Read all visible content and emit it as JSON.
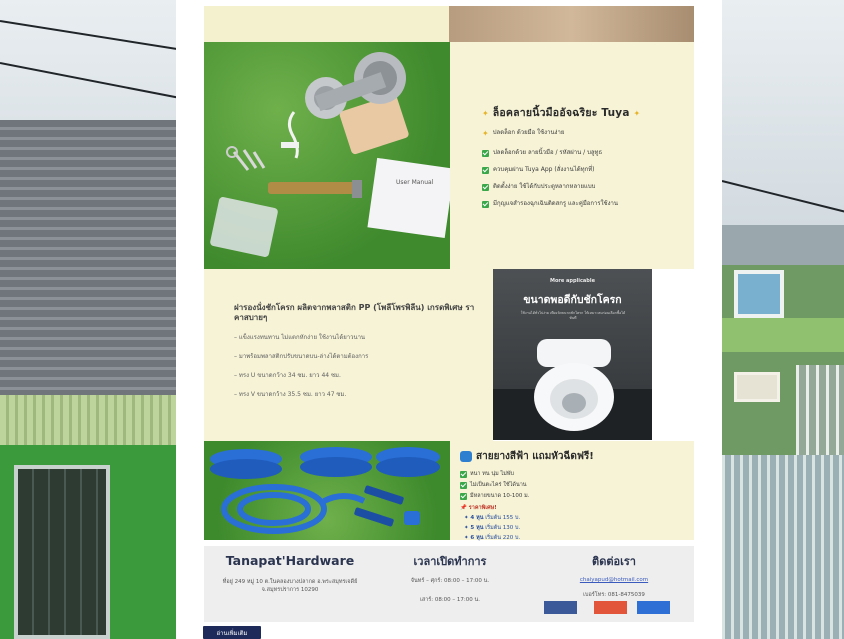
{
  "lock_panel": {
    "title": "ล็อคลายนิ้วมืออัจฉริยะ Tuya",
    "bullets": [
      "ปลดล็อก ด้วยมือ ใช้งานง่าย",
      "ปลดล็อกด้วย ลายนิ้วมือ / รหัสผ่าน / บลูทูธ",
      "ควบคุมผ่าน Tuya App (สั่งงานได้ทุกที่)",
      "ติดตั้งง่าย ใช้ได้กับประตูหลากหลายแบบ",
      "มีกุญแจสำรองฉุกเฉินติดสกรู และคู่มือการใช้งาน"
    ],
    "manual_label": "User Manual"
  },
  "seat_panel": {
    "title": "ฝารองนั่งชักโครก ผลิตจากพลาสติก PP (โพลีโพรพิลีน) เกรดพิเศษ ราคาสบายๆ",
    "lines": [
      "– แข็งแรงทนทาน ไม่แตกหักง่าย ใช้งานได้ยาวนาน",
      "– มาพร้อมพลาสติกปรับขนาดบน-ล่างได้ตามต้องการ",
      "– ทรง U ขนาดกว้าง 34 ซม. ยาว 44 ซม.",
      "– ทรง V ขนาดกว้าง 35.5 ซม. ยาว 47 ซม."
    ]
  },
  "seat_photo": {
    "small": "More applicable",
    "big": "ขนาดพอดีกับชักโครก",
    "sub": "ใช้งานได้ทั่วไปง่าย เพียงวัดขนาดชักโครก ให้เหมาะสมก่อนเลือกซื้อได้ทันที"
  },
  "hose_panel": {
    "title": "สายยางสีฟ้า แถมหัวฉีดฟรี!",
    "features": [
      "หนา ทน นุ่ม ไม่พับ",
      "ไม่เป็นตะไคร่ ใช้ได้นาน",
      "มีหลายขนาด 10-100 ม."
    ],
    "price_title": "ราคาพิเศษ!",
    "prices": [
      {
        "size": "4 หุน",
        "text": "เริ่มต้น 155 บ."
      },
      {
        "size": "5 หุน",
        "text": "เริ่มต้น 130 บ."
      },
      {
        "size": "6 หุน",
        "text": "เริ่มต้น 220 บ."
      }
    ]
  },
  "footer": {
    "brand": "Tanapat'Hardware",
    "address": "ที่อยู่ 249 หมู่ 10 ต.ในคลองบางปลากด อ.พระสมุทรเจดีย์ จ.สมุทรปราการ 10290",
    "hours_title": "เวลาเปิดทำการ",
    "hours_weekday": "จันทร์ – ศุกร์: 08:00 – 17:00 น.",
    "hours_sat": "เสาร์: 08:00 – 17:00 น.",
    "contact_title": "ติดต่อเรา",
    "email": "chaiyapud@hotmail.com",
    "phone": "เบอร์โทร: 081-8475039",
    "social_colors": [
      "#3b5998",
      "#e2553b",
      "#2d6fd4"
    ]
  },
  "read_more": "อ่านเพิ่มเติม"
}
